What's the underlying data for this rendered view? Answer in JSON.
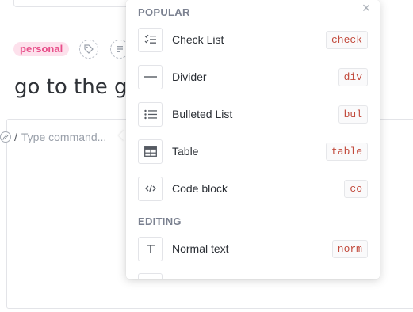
{
  "editor": {
    "tag_label": "personal",
    "task_title": "go to the gr",
    "slash": "/",
    "placeholder": "Type command..."
  },
  "popup": {
    "close_glyph": "×",
    "sections": [
      {
        "heading": "POPULAR",
        "items": [
          {
            "label": "Check List",
            "shortcut": "check",
            "icon": "checklist-icon"
          },
          {
            "label": "Divider",
            "shortcut": "div",
            "icon": "divider-icon"
          },
          {
            "label": "Bulleted List",
            "shortcut": "bul",
            "icon": "bulleted-list-icon"
          },
          {
            "label": "Table",
            "shortcut": "table",
            "icon": "table-icon"
          },
          {
            "label": "Code block",
            "shortcut": "co",
            "icon": "code-icon"
          }
        ]
      },
      {
        "heading": "EDITING",
        "items": [
          {
            "label": "Normal text",
            "shortcut": "norm",
            "icon": "text-icon"
          }
        ]
      }
    ]
  },
  "colors": {
    "tag_bg": "#fde1ec",
    "tag_text": "#e84f8a",
    "shortcut_text": "#c24a3c",
    "section_heading": "#7b8190"
  }
}
